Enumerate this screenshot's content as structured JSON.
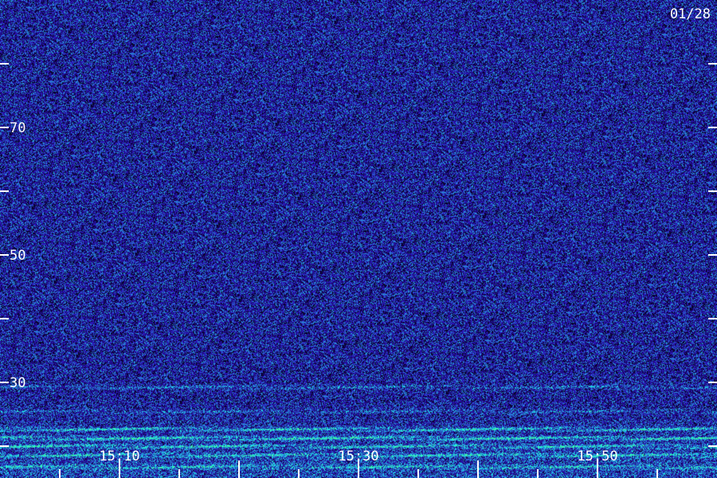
{
  "date_label": "01/28",
  "chart_data": {
    "type": "heatmap",
    "title": "",
    "xlabel": "",
    "ylabel": "",
    "x_tick_labels": [
      "15:10",
      "15:30",
      "15:50"
    ],
    "x_tick_values_min": [
      10,
      30,
      50
    ],
    "xlim_min": [
      0,
      60
    ],
    "y_tick_labels": [
      "70",
      "50",
      "30"
    ],
    "y_tick_values": [
      70,
      50,
      30
    ],
    "ylim": [
      15,
      90
    ],
    "colors": {
      "background": "#20108a",
      "dark": "#0a0230",
      "mid": "#3020c0",
      "cyan": "#28a8f0",
      "green": "#30ff80"
    },
    "features": [
      {
        "name": "band",
        "y": 29.3,
        "intensity": 0.45
      },
      {
        "name": "band",
        "y": 25.5,
        "intensity": 0.35
      },
      {
        "name": "band",
        "y": 22.7,
        "intensity": 0.8
      },
      {
        "name": "band",
        "y": 21.3,
        "intensity": 0.9
      },
      {
        "name": "band",
        "y": 20.0,
        "intensity": 0.75
      },
      {
        "name": "band",
        "y": 18.6,
        "intensity": 0.7
      },
      {
        "name": "band",
        "y": 16.8,
        "intensity": 0.6
      }
    ]
  }
}
